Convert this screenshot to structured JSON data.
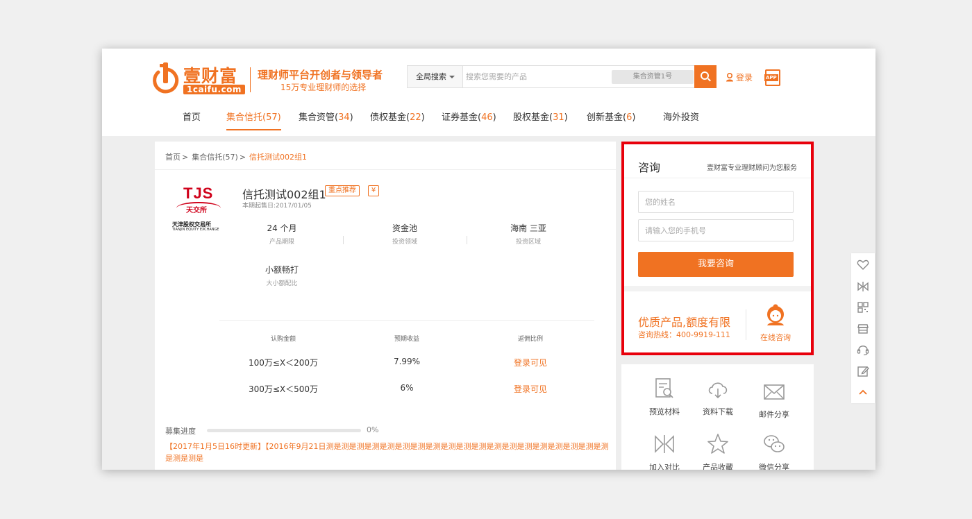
{
  "brand": {
    "name_cn": "壹财富",
    "domain": "1caifu.com",
    "slogan": "理财师平台开创者与领导者",
    "sub_slogan": "15万专业理财师的选择"
  },
  "search": {
    "scope": "全局搜索",
    "placeholder": "搜索您需要的产品",
    "hot": "集合资管1号"
  },
  "header": {
    "login": "登录",
    "app": "APP"
  },
  "nav": [
    {
      "label": "首页",
      "count": ""
    },
    {
      "label": "集合信托(",
      "count": "57",
      "close": ")"
    },
    {
      "label": "集合资管(",
      "count": "34",
      "close": ")"
    },
    {
      "label": "债权基金(",
      "count": "22",
      "close": ")"
    },
    {
      "label": "证券基金(",
      "count": "46",
      "close": ")"
    },
    {
      "label": "股权基金(",
      "count": "31",
      "close": ")"
    },
    {
      "label": "创新基金(",
      "count": "6",
      "close": ")"
    },
    {
      "label": "海外投资",
      "count": ""
    }
  ],
  "breadcrumb": {
    "home": "首页",
    "category": "集合信托(57)",
    "current": "信托测试002组1"
  },
  "issuer": {
    "abbr": "TJS",
    "name_short": "天交所",
    "name_full": "天津股权交易所",
    "name_en": "TIANJIN EQUITY EXCHANGE"
  },
  "product": {
    "title": "信托测试002组1",
    "tag": "重点推荐",
    "yen": "¥",
    "date": "本期起售日:2017/01/05",
    "attrs": [
      {
        "value": "24 个月",
        "label": "产品期限"
      },
      {
        "value": "资金池",
        "label": "投资领域"
      },
      {
        "value": "海南  三亚",
        "label": "投资区域"
      },
      {
        "value": "小额畅打",
        "label": "大小额配比"
      }
    ],
    "table_headers": [
      "认购金额",
      "预期收益",
      "返佣比例"
    ],
    "table_rows": [
      [
        "100万≤X＜200万",
        "7.99%",
        "登录可见"
      ],
      [
        "300万≤X＜500万",
        "6%",
        "登录可见"
      ]
    ]
  },
  "progress": {
    "label": "募集进度",
    "value": "0%",
    "fraction": 0
  },
  "news": "【2017年1月5日16时更新】【2016年9月21日测是测是测是测是测是测是测是测是测是测是测是测是测是测是测是测是测是测是测是测是测是",
  "consult": {
    "title": "咨询",
    "subtitle": "壹财富专业理财顾问为您服务",
    "name_placeholder": "您的姓名",
    "phone_placeholder": "请输入您的手机号",
    "button": "我要咨询",
    "slogan": "优质产品,额度有限",
    "hotline": "咨询热线：400-9919-111",
    "online": "在线咨询"
  },
  "tools": [
    {
      "label": "预览材料",
      "icon": "document-search-icon"
    },
    {
      "label": "资料下载",
      "icon": "cloud-download-icon"
    },
    {
      "label": "邮件分享",
      "icon": "mail-icon"
    },
    {
      "label": "加入对比",
      "icon": "compare-icon"
    },
    {
      "label": "产品收藏",
      "icon": "star-icon"
    },
    {
      "label": "微信分享",
      "icon": "wechat-icon"
    }
  ],
  "side_icons": [
    "heart-icon",
    "compare-icon",
    "qrcode-icon",
    "store-icon",
    "headset-icon",
    "edit-icon",
    "back-to-top-icon"
  ],
  "colors": {
    "accent": "#f07222",
    "highlight_border": "#e8000b",
    "issuer_red": "#d0021b"
  }
}
